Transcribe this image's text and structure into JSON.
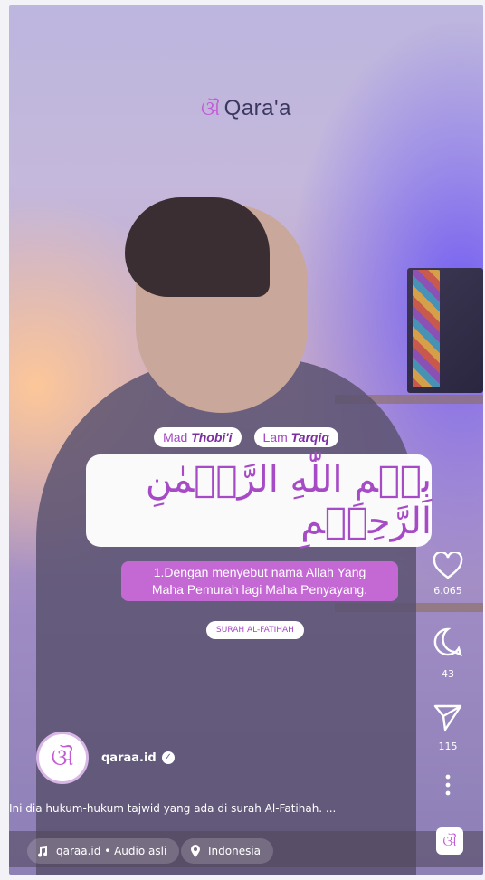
{
  "brand": {
    "logo_mark": "ଔ",
    "name": "Qara'a"
  },
  "tags": [
    {
      "prefix": "Mad ",
      "emph": "Thobi'i"
    },
    {
      "prefix": "Lam ",
      "emph": "Tarqiq"
    }
  ],
  "ayah": {
    "arabic": "بِسۡمِ اللّٰهِ الرَّحۡمٰنِ الرَّحِيۡمِ"
  },
  "translation": {
    "line1": "1.Dengan menyebut nama Allah Yang",
    "line2": "Maha Pemurah lagi Maha Penyayang."
  },
  "surah_label": "SURAH AL-FATIHAH",
  "actions": {
    "likes": "6.065",
    "comments": "43",
    "shares": "115"
  },
  "profile": {
    "username": "qaraa.id"
  },
  "caption": "Ini dia hukum-hukum tajwid yang ada di surah Al-Fatihah. ...",
  "bottom": {
    "audio": "qaraa.id • Audio asli",
    "location": "Indonesia"
  },
  "colors": {
    "accent": "#c45bd6",
    "translation_bg": "#c468d3"
  }
}
